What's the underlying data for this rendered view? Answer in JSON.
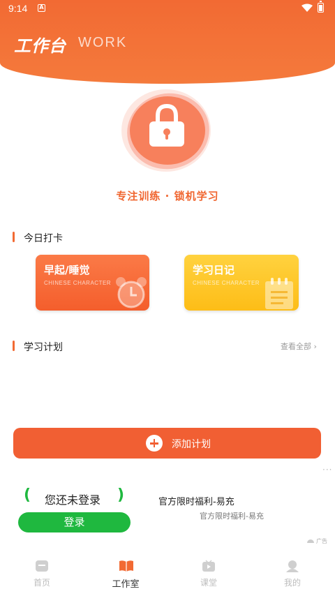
{
  "status_bar": {
    "time": "9:14",
    "notification_icon": "A"
  },
  "header": {
    "title": "工作台",
    "subtitle": "WORK"
  },
  "focus": {
    "caption": "专注训练 · 锁机学习"
  },
  "checkin": {
    "section_title": "今日打卡",
    "cards": [
      {
        "title": "早起/睡觉",
        "subtitle": "CHINESE CHARACTER",
        "icon": "alarm-clock-icon"
      },
      {
        "title": "学习日记",
        "subtitle": "CHINESE CHARACTER",
        "icon": "notebook-icon"
      }
    ]
  },
  "plan": {
    "section_title": "学习计划",
    "view_all": "查看全部 ›",
    "add_button": "添加计划"
  },
  "ad": {
    "not_logged_in": "您还未登录",
    "login_button": "登录",
    "title": "官方限时福利-易充",
    "description": "官方限时福利-易充",
    "badge": "广告"
  },
  "bottom_nav": [
    {
      "label": "首页",
      "icon": "home-icon",
      "active": false
    },
    {
      "label": "工作室",
      "icon": "book-icon",
      "active": true
    },
    {
      "label": "课堂",
      "icon": "video-icon",
      "active": false
    },
    {
      "label": "我的",
      "icon": "profile-icon",
      "active": false
    }
  ],
  "colors": {
    "accent": "#f26a33",
    "yellow_card": "#fdbd17",
    "login_green": "#1fb83f",
    "nav_inactive": "#bdbdbd"
  }
}
